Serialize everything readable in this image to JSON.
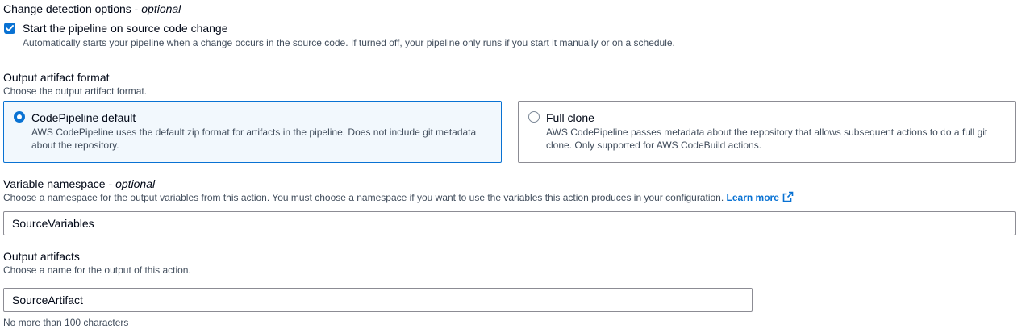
{
  "change_detection": {
    "label": "Change detection options",
    "optional": "optional",
    "checkbox_label": "Start the pipeline on source code change",
    "checkbox_checked": true,
    "checkbox_description": "Automatically starts your pipeline when a change occurs in the source code. If turned off, your pipeline only runs if you start it manually or on a schedule."
  },
  "output_artifact_format": {
    "label": "Output artifact format",
    "description": "Choose the output artifact format.",
    "options": [
      {
        "title": "CodePipeline default",
        "description": "AWS CodePipeline uses the default zip format for artifacts in the pipeline. Does not include git metadata about the repository.",
        "selected": true
      },
      {
        "title": "Full clone",
        "description": "AWS CodePipeline passes metadata about the repository that allows subsequent actions to do a full git clone. Only supported for AWS CodeBuild actions.",
        "selected": false
      }
    ]
  },
  "variable_namespace": {
    "label": "Variable namespace",
    "optional": "optional",
    "description": "Choose a namespace for the output variables from this action. You must choose a namespace if you want to use the variables this action produces in your configuration.",
    "learn_more": "Learn more",
    "learn_more_icon": "external-link-icon",
    "value": "SourceVariables"
  },
  "output_artifacts": {
    "label": "Output artifacts",
    "description": "Choose a name for the output of this action.",
    "value": "SourceArtifact",
    "constraint": "No more than 100 characters"
  },
  "colors": {
    "accent": "#0972d3",
    "selected_tile_bg": "#f2f8fd",
    "border": "#8c8c94",
    "text": "#000716",
    "secondary_text": "#414d5c"
  }
}
